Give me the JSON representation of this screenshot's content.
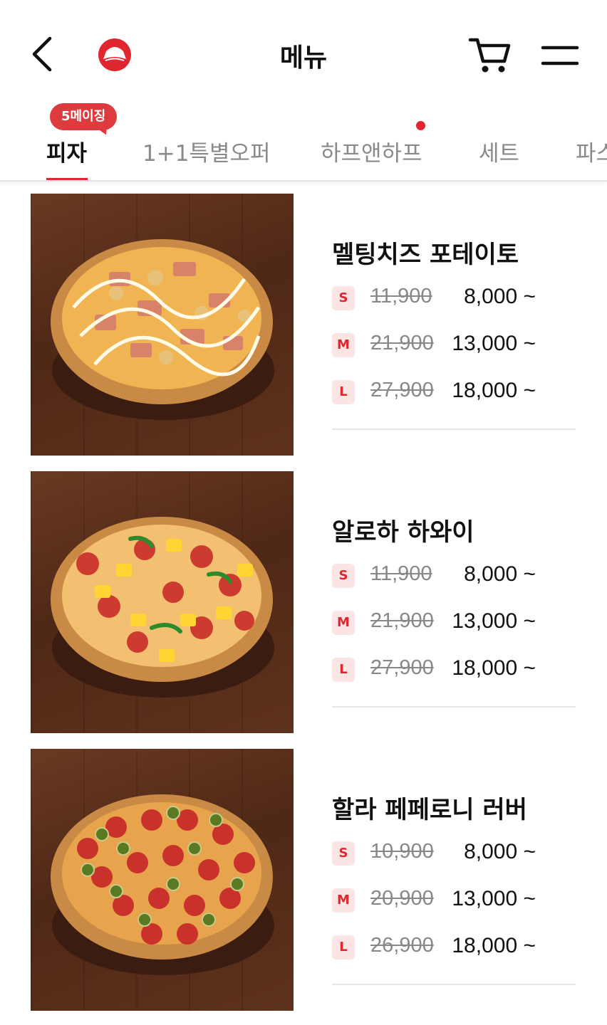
{
  "header": {
    "title": "메뉴",
    "brand_color": "#e0262f"
  },
  "tabs": [
    {
      "label": "피자",
      "active": true,
      "badge": "5메이징"
    },
    {
      "label": "1+1특별오퍼"
    },
    {
      "label": "하프앤하프",
      "has_dot": true
    },
    {
      "label": "세트"
    },
    {
      "label": "파스타"
    }
  ],
  "products": [
    {
      "name": "멜팅치즈 포테이토",
      "prices": [
        {
          "size": "S",
          "original": "11,900",
          "sale": "8,000 ~"
        },
        {
          "size": "M",
          "original": "21,900",
          "sale": "13,000 ~"
        },
        {
          "size": "L",
          "original": "27,900",
          "sale": "18,000 ~"
        }
      ]
    },
    {
      "name": "알로하 하와이",
      "prices": [
        {
          "size": "S",
          "original": "11,900",
          "sale": "8,000 ~"
        },
        {
          "size": "M",
          "original": "21,900",
          "sale": "13,000 ~"
        },
        {
          "size": "L",
          "original": "27,900",
          "sale": "18,000 ~"
        }
      ]
    },
    {
      "name": "할라 페페로니 러버",
      "prices": [
        {
          "size": "S",
          "original": "10,900",
          "sale": "8,000 ~"
        },
        {
          "size": "M",
          "original": "20,900",
          "sale": "13,000 ~"
        },
        {
          "size": "L",
          "original": "26,900",
          "sale": "18,000 ~"
        }
      ]
    }
  ]
}
